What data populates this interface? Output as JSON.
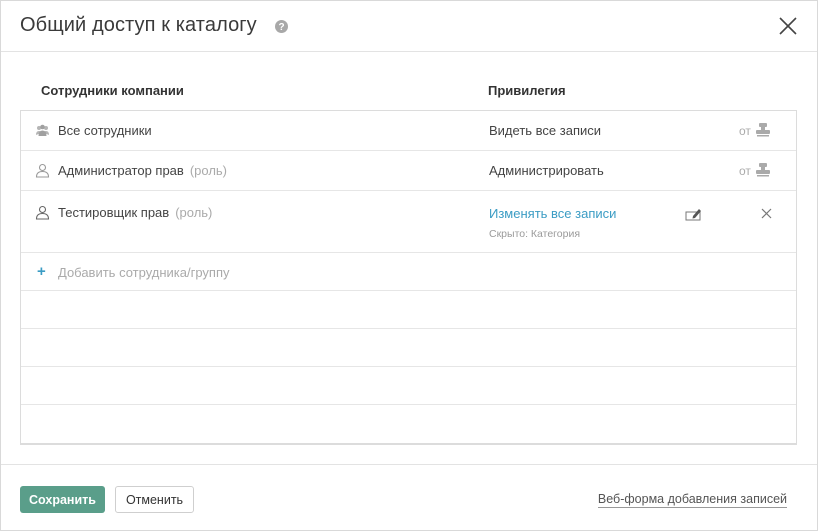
{
  "dialog": {
    "title": "Общий доступ к каталогу"
  },
  "columns": {
    "employees": "Сотрудники компании",
    "privilege": "Привилегия"
  },
  "rows": [
    {
      "name": "Все сотрудники",
      "role": "",
      "privilege": "Видеть все записи",
      "from": "от",
      "icon": "group-icon"
    },
    {
      "name": "Администратор прав",
      "role": "(роль)",
      "privilege": "Администрировать",
      "from": "от",
      "icon": "user-icon"
    },
    {
      "name": "Тестировщик прав",
      "role": "(роль)",
      "privilege": "Изменять все записи",
      "note": "Скрыто: Категория",
      "icon": "user-icon"
    }
  ],
  "add_row": {
    "label": "Добавить сотрудника/группу"
  },
  "footer": {
    "save": "Сохранить",
    "cancel": "Отменить",
    "webform": "Веб-форма добавления записей"
  },
  "colors": {
    "accent": "#3b9cc4",
    "save_button": "#5a9e8a"
  }
}
